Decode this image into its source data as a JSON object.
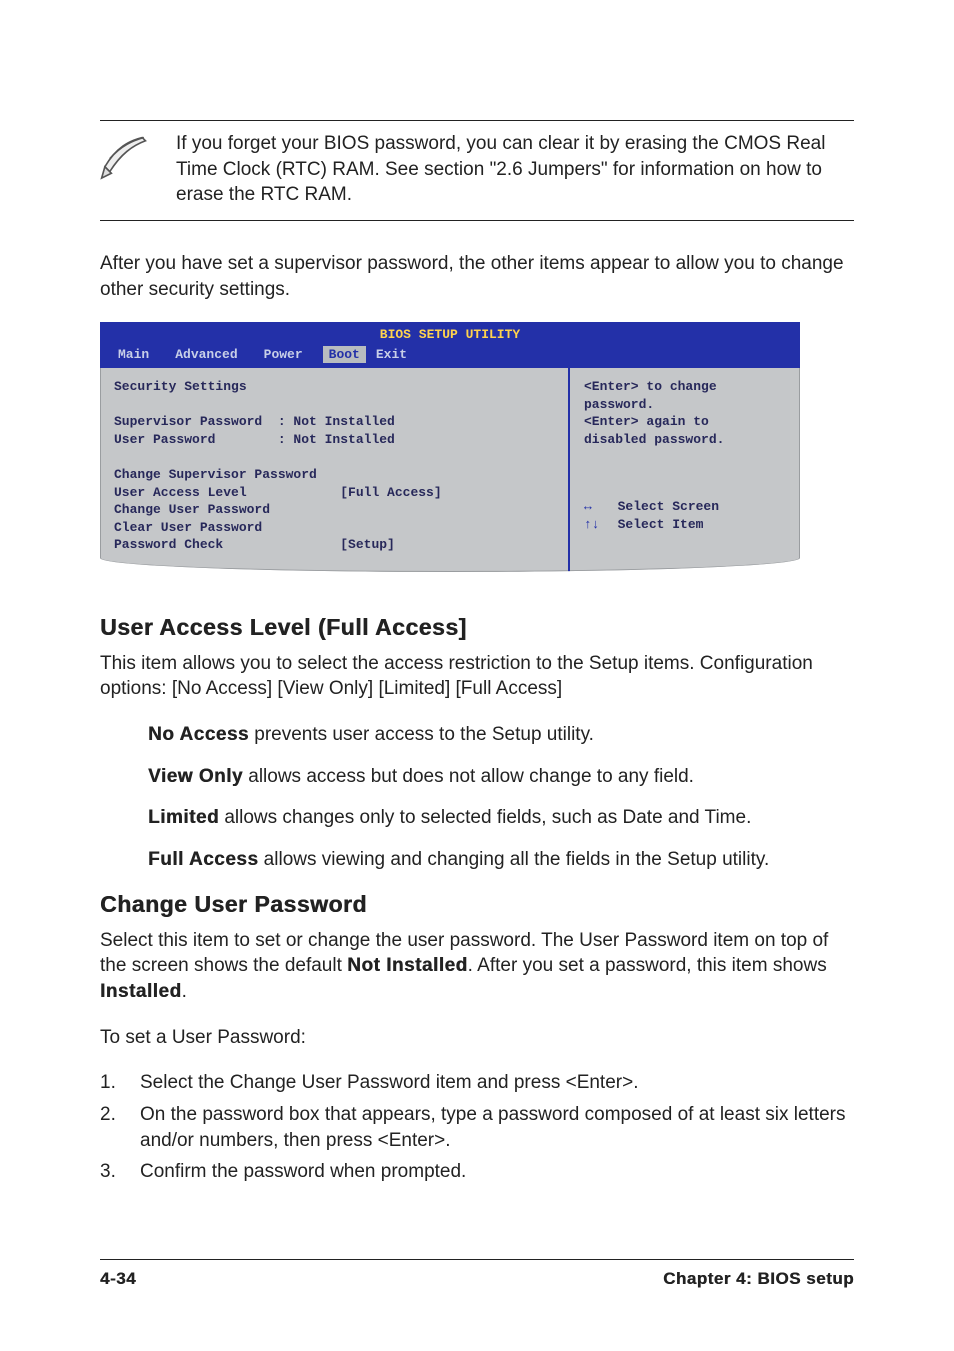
{
  "note": {
    "text": "If you forget your BIOS password, you can clear it by erasing the CMOS Real Time Clock (RTC) RAM. See section \"2.6  Jumpers\" for information on how to erase the RTC RAM."
  },
  "intro_para": "After you have set a supervisor password, the other items appear to allow you to change other security settings.",
  "bios": {
    "title": "BIOS SETUP UTILITY",
    "tabs": [
      "Main",
      "Advanced",
      "Power",
      "Boot",
      "Exit"
    ],
    "selected_tab": "Boot",
    "left_raw": "Security Settings\n\nSupervisor Password  : Not Installed\nUser Password        : Not Installed\n\nChange Supervisor Password\nUser Access Level            [Full Access]\nChange User Password\nClear User Password\nPassword Check               [Setup]",
    "help1": "<Enter> to change",
    "help2": "password.",
    "help3": "<Enter> again to",
    "help4": "disabled password.",
    "nav1_sym": "↔",
    "nav1_lbl": "Select Screen",
    "nav2_sym": "↑↓",
    "nav2_lbl": "Select Item"
  },
  "section1": {
    "heading": "User Access Level (Full Access]",
    "desc": "This item allows you to select the access restriction to the Setup items. Configuration options: [No Access] [View Only] [Limited] [Full Access]",
    "defs": [
      {
        "term": "No Access",
        "rest": " prevents user access to the Setup utility."
      },
      {
        "term": "View Only",
        "rest": " allows access but does not allow change to any field."
      },
      {
        "term": "Limited",
        "rest": " allows changes only to selected fields, such as Date and Time."
      },
      {
        "term": "Full Access",
        "rest": " allows viewing and changing all the fields in the Setup utility."
      }
    ]
  },
  "section2": {
    "heading": "Change User Password",
    "p1a": "Select this item to set or change the user password. The User Password item on top of the screen shows the default ",
    "p1b": "Not Installed",
    "p1c": ". After you set a password, this item shows ",
    "p1d": "Installed",
    "p1e": ".",
    "p2": "To set a User Password:",
    "steps": [
      "Select the Change User Password item and press <Enter>.",
      "On the password box that appears, type a password composed of at least six letters and/or numbers, then press <Enter>.",
      "Confirm the password when prompted."
    ]
  },
  "footer": {
    "left": "4-34",
    "right": "Chapter 4: BIOS setup"
  }
}
